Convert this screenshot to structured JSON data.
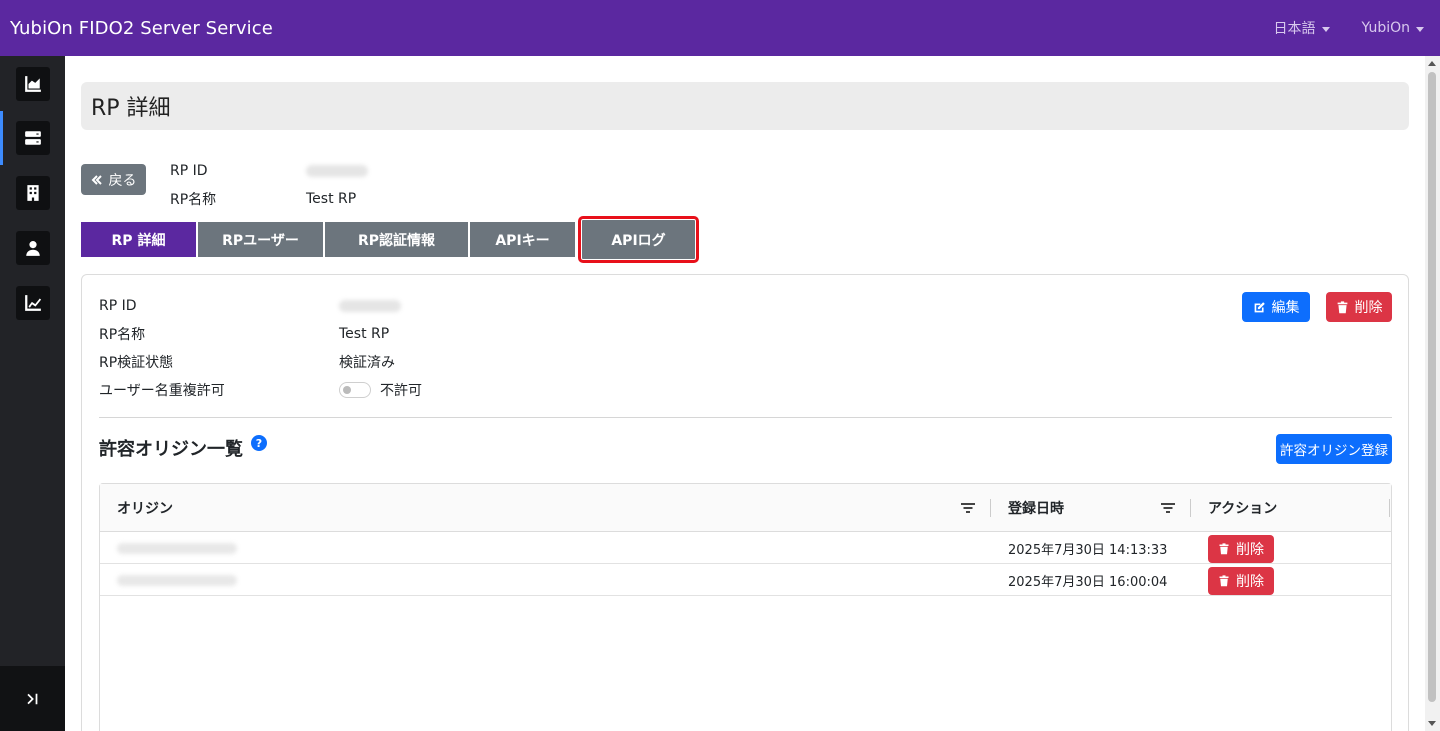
{
  "app": {
    "title": "YubiOn FIDO2 Server Service",
    "language": "日本語",
    "user": "YubiOn"
  },
  "page": {
    "title": "RP 詳細",
    "back_label": "戻る"
  },
  "summary": {
    "rp_id_label": "RP ID",
    "rp_name_label": "RP名称",
    "rp_name_value": "Test RP"
  },
  "tabs": [
    {
      "label": "RP 詳細",
      "active": true
    },
    {
      "label": "RPユーザー",
      "active": false
    },
    {
      "label": "RP認証情報",
      "active": false
    },
    {
      "label": "APIキー",
      "active": false
    },
    {
      "label": "APIログ",
      "active": false,
      "highlighted": true
    }
  ],
  "details": {
    "rp_id_label": "RP ID",
    "rp_name_label": "RP名称",
    "rp_name_value": "Test RP",
    "verify_label": "RP検証状態",
    "verify_value": "検証済み",
    "dup_label": "ユーザー名重複許可",
    "dup_value": "不許可",
    "edit_label": "編集",
    "delete_label": "削除"
  },
  "origins": {
    "title": "許容オリジン一覧",
    "help": "?",
    "register_label": "許容オリジン登録",
    "columns": [
      "オリジン",
      "登録日時",
      "アクション"
    ],
    "rows": [
      {
        "date": "2025年7月30日 14:13:33",
        "action": "削除"
      },
      {
        "date": "2025年7月30日 16:00:04",
        "action": "削除"
      }
    ]
  },
  "colors": {
    "brand": "#5b28a0",
    "primary": "#0d6efd",
    "danger": "#dc3545",
    "secondary": "#6c757d",
    "highlight": "#e8101a"
  }
}
